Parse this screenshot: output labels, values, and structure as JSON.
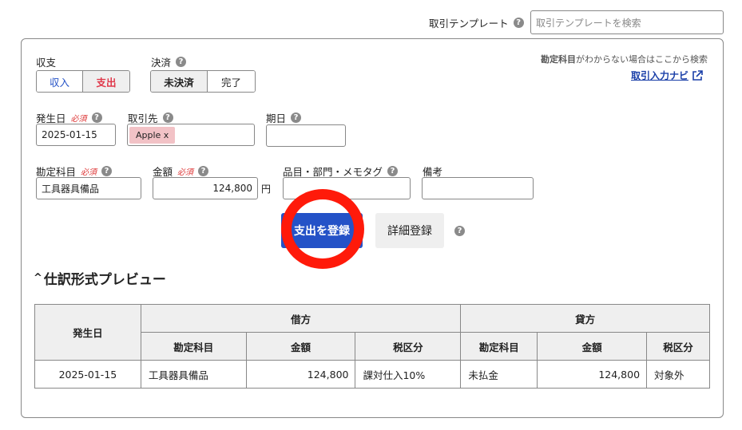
{
  "template_search": {
    "label": "取引テンプレート",
    "placeholder": "取引テンプレートを検索"
  },
  "form": {
    "income_expense": {
      "label": "収支",
      "income": "収入",
      "expense": "支出"
    },
    "settlement": {
      "label": "決済",
      "unsettled": "未決済",
      "settled": "完了"
    },
    "nav_hint": "勘定科目がわからない場合はここから検索",
    "nav_hint_bold": "勘定科目",
    "nav_hint_rest": "がわからない場合はここから検索",
    "nav_link": "取引入力ナビ",
    "issue_date": {
      "label": "発生日",
      "required": "必須",
      "value": "2025-01-15"
    },
    "partner": {
      "label": "取引先",
      "tag": "Apple x"
    },
    "due_date": {
      "label": "期日"
    },
    "account": {
      "label": "勘定科目",
      "required": "必須",
      "value": "工具器具備品"
    },
    "amount": {
      "label": "金額",
      "required": "必須",
      "value": "124,800",
      "unit": "円"
    },
    "item": {
      "label": "品目・部門・メモタグ"
    },
    "note": {
      "label": "備考"
    },
    "register_button": "支出を登録",
    "detail_button": "詳細登録",
    "help_mark": "?"
  },
  "preview": {
    "toggle": "^",
    "title": "仕訳形式プレビュー",
    "headers": {
      "date": "発生日",
      "debit": "借方",
      "credit": "貸方",
      "account": "勘定科目",
      "amount": "金額",
      "tax": "税区分"
    },
    "row": {
      "date": "2025-01-15",
      "debit_account": "工具器具備品",
      "debit_amount": "124,800",
      "debit_tax": "課対仕入10%",
      "credit_account": "未払金",
      "credit_amount": "124,800",
      "credit_tax": "対象外"
    }
  },
  "colors": {
    "primary": "#2452c7",
    "expense_red": "#e0394b",
    "annotation_red": "#ff1a0a",
    "link_blue": "#1a3fa8"
  }
}
